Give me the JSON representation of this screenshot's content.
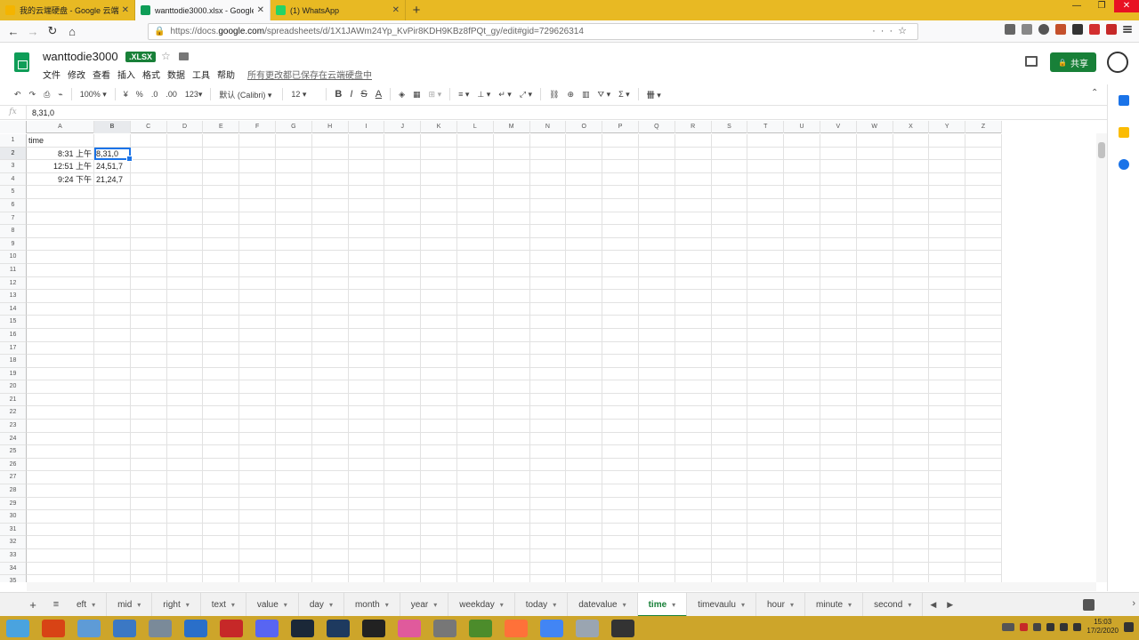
{
  "browser": {
    "tabs": [
      {
        "title": "我的云端硬盘 - Google 云端硬",
        "color": "#f4b400",
        "active": false
      },
      {
        "title": "wanttodie3000.xlsx - Google",
        "color": "#0f9d58",
        "active": true
      },
      {
        "title": "(1) WhatsApp",
        "color": "#25d366",
        "active": false
      }
    ],
    "new_tab_label": "+",
    "url_prefix": "https://docs.",
    "url_host": "google.com",
    "url_path": "/spreadsheets/d/1X1JAWm24Yp_KvPir8KDH9KBz8fPQt_gy/edit#gid=729626314"
  },
  "doc": {
    "title": "wanttodie3000",
    "badge": ".XLSX",
    "menus": [
      "文件",
      "修改",
      "查看",
      "插入",
      "格式",
      "数据",
      "工具",
      "帮助"
    ],
    "save_status": "所有更改都已保存在云端硬盘中",
    "share_label": "共享",
    "share_icon": "lock-icon"
  },
  "toolbar": {
    "zoom": "100%",
    "currency": "¥",
    "percent": "%",
    "dec_decrease": ".0",
    "dec_increase": ".00",
    "more_formats": "123",
    "font": "默认 (Calibri)",
    "font_size": "12",
    "bold": "B",
    "italic": "I",
    "strike": "S",
    "text_color": "A"
  },
  "formula": {
    "fx": "fx",
    "value": "8,31,0"
  },
  "grid": {
    "columns": [
      "A",
      "B",
      "C",
      "D",
      "E",
      "F",
      "G",
      "H",
      "I",
      "J",
      "K",
      "L",
      "M",
      "N",
      "O",
      "P",
      "Q",
      "R",
      "S",
      "T",
      "U",
      "V",
      "W",
      "X",
      "Y",
      "Z"
    ],
    "selected_column": "B",
    "selected_row": "2",
    "row_numbers": [
      "1",
      "2",
      "3",
      "4",
      "5",
      "6",
      "7",
      "8",
      "9",
      "10",
      "11",
      "12",
      "13",
      "14",
      "15",
      "16",
      "17",
      "18",
      "19",
      "20",
      "21",
      "22",
      "23",
      "24",
      "25",
      "26",
      "27",
      "28",
      "29",
      "30",
      "31",
      "32",
      "33",
      "34",
      "35"
    ],
    "cells": {
      "A1": "time",
      "A2": "8:31 上午",
      "A3": "12:51 上午",
      "A4": "9:24 下午",
      "B2": "8,31,0",
      "B3": "24,51,7",
      "B4": "21,24,7"
    }
  },
  "sheets": {
    "tabs": [
      "eft",
      "mid",
      "right",
      "text",
      "value",
      "day",
      "month",
      "year",
      "weekday",
      "today",
      "datevalue",
      "time",
      "timevaulu",
      "hour",
      "minute",
      "second"
    ],
    "active": "time",
    "add_label": "+",
    "list_label": "≡"
  },
  "taskbar": {
    "time": "15:03",
    "date": "17/2/2020",
    "icons": [
      "#4aa3df",
      "#d84315",
      "#5e9bd6",
      "#3b78c4",
      "#7a8a99",
      "#2a6fc9",
      "#c62828",
      "#5865f2",
      "#1b2838",
      "#1e3a5f",
      "#222222",
      "#e05a9c",
      "#777777",
      "#4c8c2b",
      "#ff7139",
      "#4285f4",
      "#9aa5b1",
      "#333333"
    ]
  }
}
